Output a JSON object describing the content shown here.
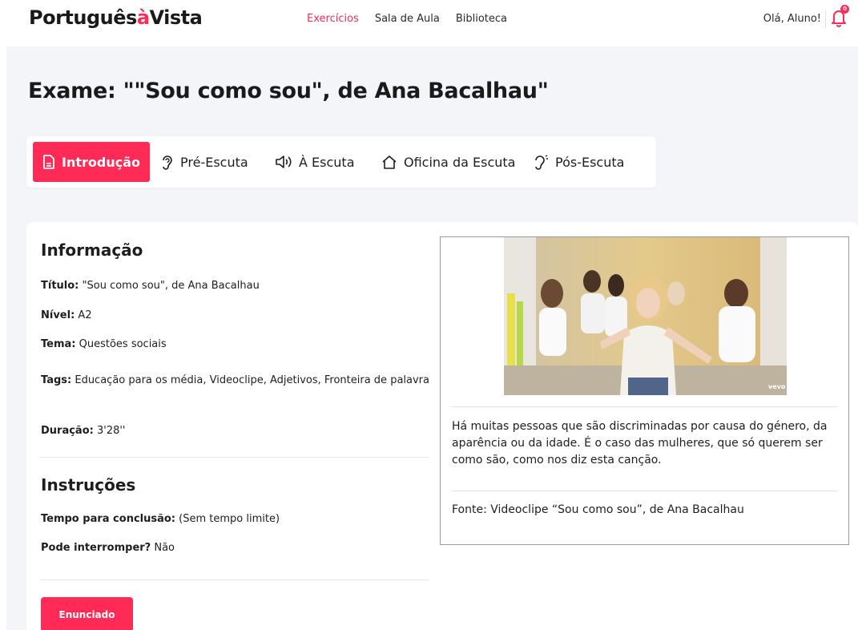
{
  "app": {
    "logo_part1": "Português",
    "logo_accent": "à",
    "logo_part2": "Vista"
  },
  "nav": {
    "items": [
      {
        "label": "Exercícios",
        "active": true
      },
      {
        "label": "Sala de Aula",
        "active": false
      },
      {
        "label": "Biblioteca",
        "active": false
      }
    ],
    "greeting": "Olá, Aluno!",
    "notifications": "0"
  },
  "page": {
    "title": "Exame: \"\"Sou como sou\", de Ana Bacalhau\""
  },
  "tabs": [
    {
      "label": "Introdução",
      "icon": "document-icon",
      "active": true
    },
    {
      "label": "Pré-Escuta",
      "icon": "ear-icon",
      "active": false
    },
    {
      "label": "À Escuta",
      "icon": "speaker-icon",
      "active": false
    },
    {
      "label": "Oficina da Escuta",
      "icon": "home-icon",
      "active": false
    },
    {
      "label": "Pós-Escuta",
      "icon": "ear-sound-icon",
      "active": false
    }
  ],
  "info": {
    "heading": "Informação",
    "titulo_label": "Título:",
    "titulo_value": " \"Sou como sou\", de Ana Bacalhau",
    "nivel_label": "Nível:",
    "nivel_value": " A2",
    "tema_label": "Tema:",
    "tema_value": " Questões sociais",
    "tags_label": "Tags:",
    "tags_value": " Educação para os média, Videoclipe, Adjetivos, Fronteira de palavra",
    "duracao_label": "Duração:",
    "duracao_value": " 3'28''"
  },
  "instructions": {
    "heading": "Instruções",
    "tempo_label": "Tempo para conclusão:",
    "tempo_value": " (Sem tempo limite)",
    "pode_label": "Pode interromper?",
    "pode_value": " Não"
  },
  "button": {
    "label": "Enunciado"
  },
  "media": {
    "watermark": "vevo",
    "description": "Há muitas pessoas que são discriminadas por causa do género, da aparência ou da idade. É o caso das mulheres, que só querem ser como são, como nos diz esta canção.",
    "source": "Fonte: Videoclipe “Sou como sou”, de Ana Bacalhau"
  },
  "colors": {
    "accent": "#ff2a55",
    "background": "#f3f5f9"
  }
}
